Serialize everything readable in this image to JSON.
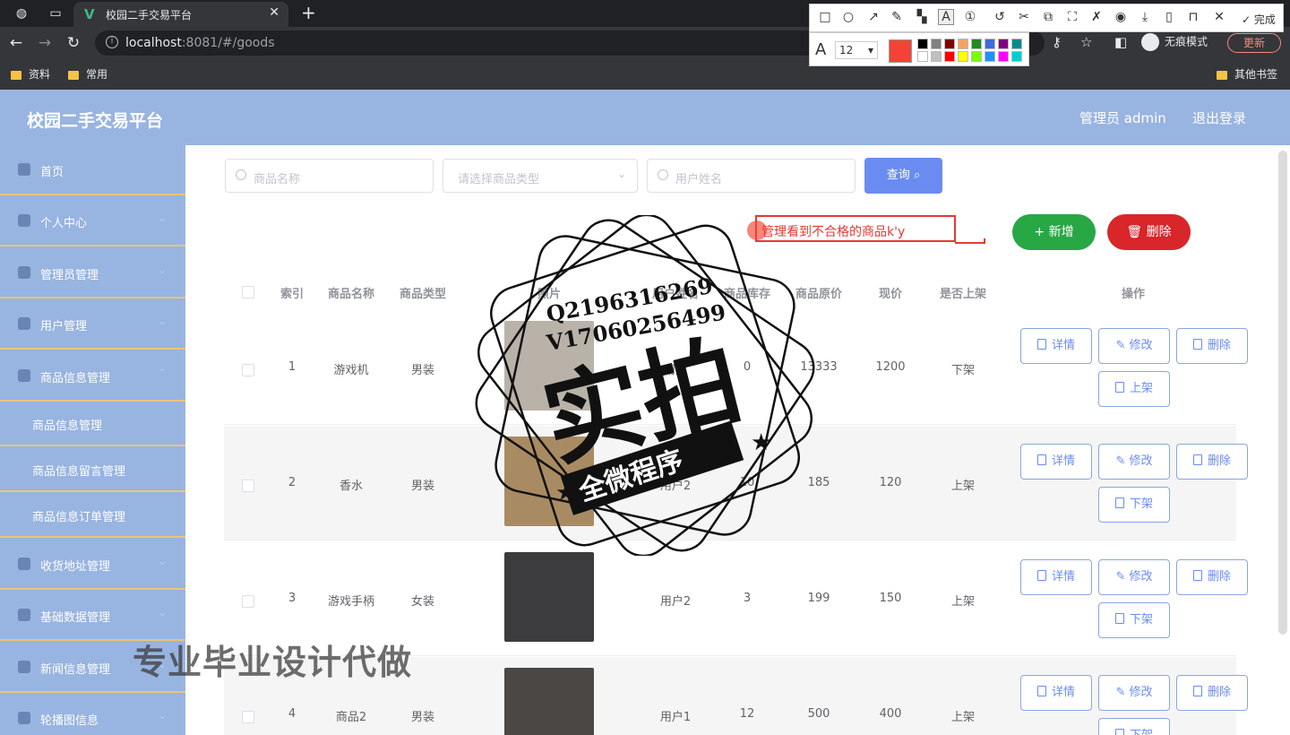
{
  "browser": {
    "tab_title": "校园二手交易平台",
    "url_host": "localhost",
    "url_path": ":8081/#/goods",
    "incognito_label": "无痕模式",
    "update_label": "更新",
    "bookmarks": [
      "资料",
      "常用",
      "其他书签"
    ]
  },
  "annotation_toolbar": {
    "done_label": "完成",
    "font_size": "12",
    "current_color": "#f44336",
    "palette": [
      "#000000",
      "#808080",
      "#800000",
      "#f4a460",
      "#228b22",
      "#4169e1",
      "#800080",
      "#008b8b",
      "#ffffff",
      "#c0c0c0",
      "#ff0000",
      "#ffff00",
      "#7cfc00",
      "#1e90ff",
      "#ff00ff",
      "#00ced1"
    ]
  },
  "header": {
    "brand": "校园二手交易平台",
    "user_label": "管理员 admin",
    "logout": "退出登录"
  },
  "sidebar": {
    "items": [
      {
        "label": "首页"
      },
      {
        "label": "个人中心"
      },
      {
        "label": "管理员管理"
      },
      {
        "label": "用户管理"
      },
      {
        "label": "商品信息管理"
      },
      {
        "label": "收货地址管理"
      },
      {
        "label": "基础数据管理"
      },
      {
        "label": "新闻信息管理"
      },
      {
        "label": "轮播图信息"
      }
    ],
    "sub_items": [
      {
        "label": "商品信息管理"
      },
      {
        "label": "商品信息留言管理"
      },
      {
        "label": "商品信息订单管理"
      }
    ]
  },
  "search": {
    "name_placeholder": "商品名称",
    "type_placeholder": "请选择商品类型",
    "user_placeholder": "用户姓名",
    "query_label": "查询"
  },
  "annotation_note": "管理看到不合格的商品k'y",
  "actions": {
    "add_label": "新增",
    "delete_label": "删除"
  },
  "table": {
    "columns": [
      "索引",
      "商品名称",
      "商品类型",
      "照片",
      "用户姓名",
      "商品库存",
      "商品原价",
      "现价",
      "是否上架",
      "操作"
    ],
    "rows": [
      {
        "index": "1",
        "name": "游戏机",
        "type": "男装",
        "user": "用户",
        "stock": "0",
        "orig": "13333",
        "price": "1200",
        "status": "下架",
        "toggle": "上架",
        "photo_color": "#b9b2a8"
      },
      {
        "index": "2",
        "name": "香水",
        "type": "男装",
        "user": "用户2",
        "stock": "10",
        "orig": "185",
        "price": "120",
        "status": "上架",
        "toggle": "下架",
        "photo_color": "#a98b63"
      },
      {
        "index": "3",
        "name": "游戏手柄",
        "type": "女装",
        "user": "用户2",
        "stock": "3",
        "orig": "199",
        "price": "150",
        "status": "上架",
        "toggle": "下架",
        "photo_color": "#3c3c3e"
      },
      {
        "index": "4",
        "name": "商品2",
        "type": "男装",
        "user": "用户1",
        "stock": "12",
        "orig": "500",
        "price": "400",
        "status": "上架",
        "toggle": "下架",
        "photo_color": "#4b4744"
      }
    ],
    "op_detail": "详情",
    "op_edit": "修改",
    "op_delete": "删除"
  },
  "watermark": {
    "line1": "Q2196316269",
    "line2": "V17060256499",
    "main": "实拍",
    "banner": "全微程序",
    "bottom": "专业毕业设计代做"
  }
}
